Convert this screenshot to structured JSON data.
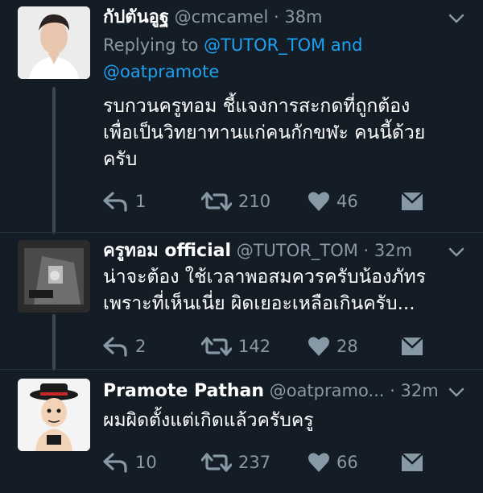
{
  "tweets": [
    {
      "name": "กัปตันอูฐ",
      "handle": "@cmcamel",
      "time": "· 38m",
      "replying_label": "Replying to",
      "reply_mention_1": "@TUTOR_TOM",
      "reply_and": "and",
      "reply_mention_2": "@oatpramote",
      "text": "รบกวนครูทอม ชี้แจงการสะกดที่ถูกต้อง\nเพื่อเป็นวิทยาทานแก่คนกักขฬะ คนนี้ด้วย\nครับ",
      "replies": "1",
      "retweets": "210",
      "likes": "46"
    },
    {
      "name": "ครูทอม official",
      "handle": "@TUTOR_TOM",
      "time": "· 32m",
      "text": "น่าจะต้อง ใช้เวลาพอสมควรครับน้องภัทร\nเพราะที่เห็นเนี่ย ผิดเยอะเหลือเกินครับ...",
      "replies": "2",
      "retweets": "142",
      "likes": "28"
    },
    {
      "name": "Pramote Pathan",
      "handle": "@oatpramo...",
      "time": "· 32m",
      "text": "ผมผิดตั้งแต่เกิดแล้วครับครู",
      "replies": "10",
      "retweets": "237",
      "likes": "66"
    }
  ],
  "icons": {
    "reply": "reply-icon",
    "retweet": "retweet-icon",
    "like": "heart-icon",
    "dm": "direct-message-icon",
    "more": "chevron-down-icon"
  },
  "colors": {
    "background": "#141d26",
    "text_primary": "#ffffff",
    "text_secondary": "#8899a6",
    "link": "#1da1f2"
  }
}
